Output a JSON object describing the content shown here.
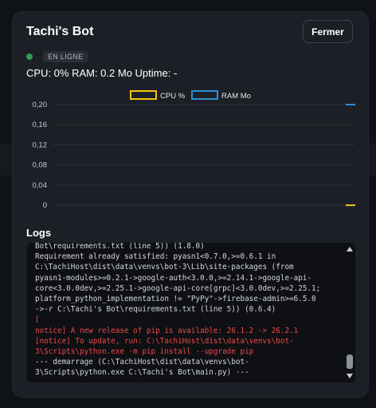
{
  "modal": {
    "title": "Tachi's Bot",
    "close_label": "Fermer"
  },
  "status": {
    "label": "EN LIGNE",
    "color": "#2e9d4f"
  },
  "stats": {
    "text": "CPU: 0% RAM: 0.2 Mo Uptime: -"
  },
  "chart_data": {
    "type": "line",
    "series": [
      {
        "name": "CPU %",
        "color": "#f2c513",
        "values": [
          0
        ]
      },
      {
        "name": "RAM Mo",
        "color": "#2f8fd6",
        "values": [
          0.2
        ]
      }
    ],
    "yticks": [
      "0,20",
      "0,16",
      "0,12",
      "0,08",
      "0,04",
      "0"
    ],
    "ylim": [
      0,
      0.2
    ],
    "legend": "top-center",
    "grid": true
  },
  "logs": {
    "title": "Logs",
    "lines": [
      {
        "text": "Bot\\requirements.txt (line 5)) (1.8.0)",
        "error": false
      },
      {
        "text": "Requirement already satisfied: pyasn1<0.7.0,>=0.6.1 in",
        "error": false
      },
      {
        "text": "C:\\TachiHost\\dist\\data\\venvs\\bot-3\\Lib\\site-packages (from",
        "error": false
      },
      {
        "text": "pyasn1-modules>=0.2.1->google-auth<3.0.0,>=2.14.1->google-api-",
        "error": false
      },
      {
        "text": "core<3.0.0dev,>=2.25.1->google-api-core[grpc]<3.0.0dev,>=2.25.1;",
        "error": false
      },
      {
        "text": "platform_python_implementation != \"PyPy\"->firebase-admin>=6.5.0",
        "error": false
      },
      {
        "text": "->-r C:\\Tachi's Bot\\requirements.txt (line 5)) (0.6.4)",
        "error": false
      },
      {
        "text": "[",
        "error": true
      },
      {
        "text": "notice] A new release of pip is available: 26.1.2 -> 26.2.1",
        "error": true
      },
      {
        "text": "[notice] To update, run: C:\\TachiHost\\dist\\data\\venvs\\bot-",
        "error": true
      },
      {
        "text": "3\\Scripts\\python.exe -m pip install --upgrade pip",
        "error": true
      },
      {
        "text": "--- demarrage (C:\\TachiHost\\dist\\data\\venvs\\bot-",
        "error": false
      },
      {
        "text": "3\\Scripts\\python.exe C:\\Tachi's Bot\\main.py) ---",
        "error": false
      }
    ]
  }
}
